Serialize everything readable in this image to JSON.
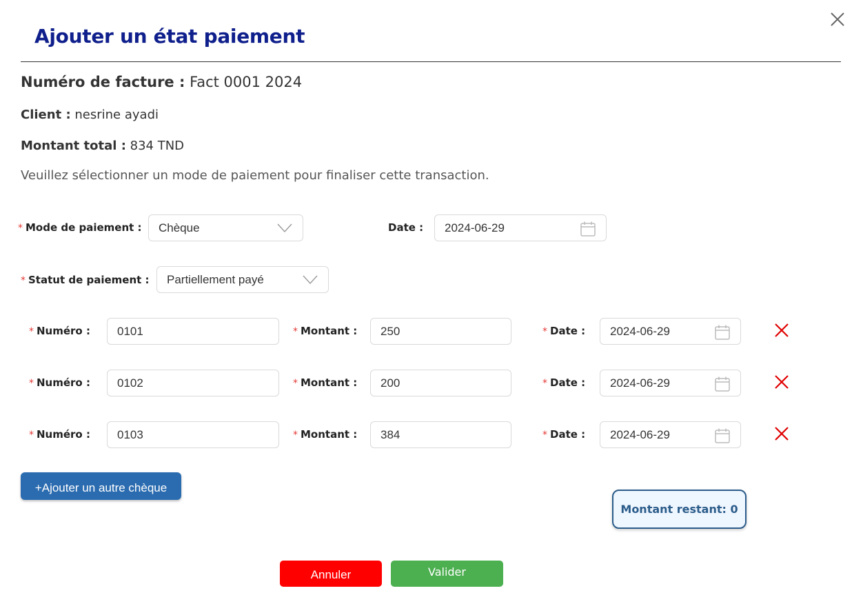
{
  "dialog": {
    "title": "Ajouter un état paiement",
    "close_icon": "close-icon"
  },
  "invoice": {
    "number_label": "Numéro de facture :",
    "number_value": "Fact 0001 2024",
    "client_label": "Client :",
    "client_value": "nesrine ayadi",
    "total_label": "Montant total :",
    "total_value": "834 TND",
    "instruction": "Veuillez sélectionner un mode de paiement pour finaliser cette transaction."
  },
  "form": {
    "required_mark": "*",
    "mode_label": "Mode de paiement :",
    "mode_value": "Chèque",
    "date_label": "Date :",
    "date_value": "2024-06-29",
    "status_label": "Statut de paiement :",
    "status_value": "Partiellement payé"
  },
  "cheques": [
    {
      "numero_label": "Numéro :",
      "numero": "0101",
      "montant_label": "Montant :",
      "montant": "250",
      "date_label": "Date :",
      "date": "2024-06-29"
    },
    {
      "numero_label": "Numéro :",
      "numero": "0102",
      "montant_label": "Montant :",
      "montant": "200",
      "date_label": "Date :",
      "date": "2024-06-29"
    },
    {
      "numero_label": "Numéro :",
      "numero": "0103",
      "montant_label": "Montant :",
      "montant": "384",
      "date_label": "Date :",
      "date": "2024-06-29"
    }
  ],
  "actions": {
    "add_cheque": "+Ajouter un autre chèque",
    "remaining": "Montant restant: 0",
    "cancel": "Annuler",
    "validate": "Valider"
  },
  "colors": {
    "title": "#0f1f8c",
    "required": "#e53935",
    "delete": "#e00000",
    "primary": "#2b6cb0",
    "cancel": "#ff0000",
    "validate": "#4caf50"
  }
}
